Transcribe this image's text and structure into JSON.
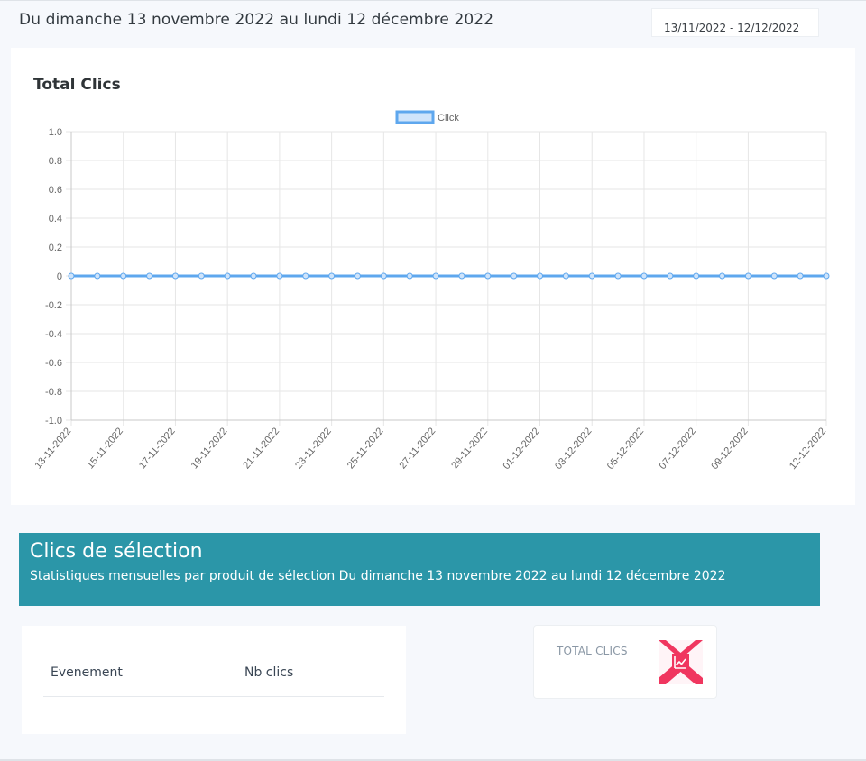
{
  "header": {
    "period_title": "Du dimanche 13 novembre 2022 au lundi 12 décembre 2022",
    "date_range": "13/11/2022 - 12/12/2022"
  },
  "chart_card": {
    "title": "Total Clics"
  },
  "chart_data": {
    "type": "line",
    "title": "Total Clics",
    "x": [
      "13-11-2022",
      "14-11-2022",
      "15-11-2022",
      "16-11-2022",
      "17-11-2022",
      "18-11-2022",
      "19-11-2022",
      "20-11-2022",
      "21-11-2022",
      "22-11-2022",
      "23-11-2022",
      "24-11-2022",
      "25-11-2022",
      "26-11-2022",
      "27-11-2022",
      "28-11-2022",
      "29-11-2022",
      "30-11-2022",
      "01-12-2022",
      "02-12-2022",
      "03-12-2022",
      "04-12-2022",
      "05-12-2022",
      "06-12-2022",
      "07-12-2022",
      "08-12-2022",
      "09-12-2022",
      "10-12-2022",
      "11-12-2022",
      "12-12-2022"
    ],
    "x_tick_labels": [
      "13-11-2022",
      "15-11-2022",
      "17-11-2022",
      "19-11-2022",
      "21-11-2022",
      "23-11-2022",
      "25-11-2022",
      "27-11-2022",
      "29-11-2022",
      "01-12-2022",
      "03-12-2022",
      "05-12-2022",
      "07-12-2022",
      "09-12-2022",
      "12-12-2022"
    ],
    "series": [
      {
        "name": "Click",
        "values": [
          0,
          0,
          0,
          0,
          0,
          0,
          0,
          0,
          0,
          0,
          0,
          0,
          0,
          0,
          0,
          0,
          0,
          0,
          0,
          0,
          0,
          0,
          0,
          0,
          0,
          0,
          0,
          0,
          0,
          0
        ]
      }
    ],
    "y_ticks": [
      "1.0",
      "0.8",
      "0.6",
      "0.4",
      "0.2",
      "0",
      "-0.2",
      "-0.4",
      "-0.6",
      "-0.8",
      "-1.0"
    ],
    "ylim": [
      -1,
      1
    ],
    "grid": true,
    "legend": "top-center",
    "colors": {
      "line": "#5ea7ee",
      "fill": "#cfe4fb",
      "grid": "#e6e6e6",
      "axis": "#c8c8c8",
      "tick_text": "#666666"
    }
  },
  "banner": {
    "title": "Clics de sélection",
    "subtitle": "Statistiques mensuelles par produit de sélection Du dimanche 13 novembre 2022 au lundi 12 décembre 2022",
    "color": "#2b96a8"
  },
  "table": {
    "headers": [
      "Evenement",
      "Nb clics"
    ],
    "rows": []
  },
  "total": {
    "label": "TOTAL CLICS",
    "icon": "chart-icon",
    "icon_color": "#f0365f"
  }
}
